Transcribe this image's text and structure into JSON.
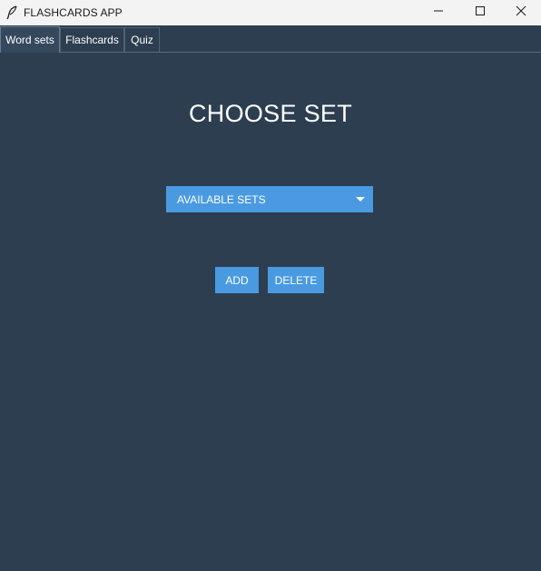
{
  "window": {
    "title": "FLASHCARDS APP",
    "controls": {
      "minimize_icon": "minimize-icon",
      "maximize_icon": "maximize-icon",
      "close_icon": "close-icon"
    }
  },
  "tabs": [
    {
      "label": "Word sets",
      "active": true
    },
    {
      "label": "Flashcards",
      "active": false
    },
    {
      "label": "Quiz",
      "active": false
    }
  ],
  "main": {
    "heading": "CHOOSE SET",
    "dropdown": {
      "selected": "AVAILABLE SETS",
      "icon": "caret-down-icon"
    },
    "buttons": {
      "add": "ADD",
      "delete": "DELETE"
    }
  },
  "colors": {
    "background": "#2c3e50",
    "accent": "#4a9ae1",
    "text": "#ffffff",
    "titlebar": "#f3f3f3"
  }
}
